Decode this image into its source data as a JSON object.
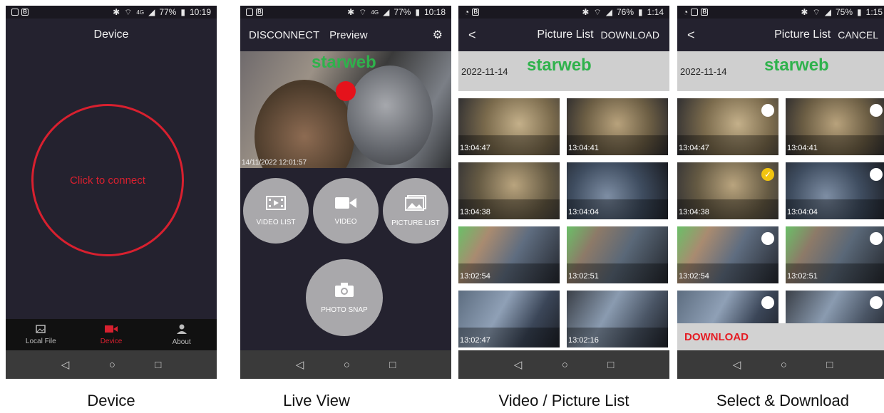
{
  "screens": [
    {
      "status": {
        "icons": [
          "▬",
          "B"
        ],
        "right": [
          "✱",
          "⌔",
          "4G",
          "◢",
          "77%",
          "▮",
          "10:19"
        ]
      },
      "title": "Device",
      "connect_label": "Click to connect",
      "tabs": [
        {
          "label": "Local File",
          "icon": "image-icon"
        },
        {
          "label": "Device",
          "icon": "camera-icon"
        },
        {
          "label": "About",
          "icon": "user-icon"
        }
      ],
      "caption": "Device"
    },
    {
      "status": {
        "icons": [
          "▬",
          "B"
        ],
        "right": [
          "✱",
          "⌔",
          "4G",
          "◢",
          "77%",
          "▮",
          "10:18"
        ]
      },
      "disconnect": "DISCONNECT",
      "preview": "Preview",
      "watermark": "starweb",
      "timestamp": "14/11/2022  12:01:57",
      "buttons": [
        "VIDEO LIST",
        "VIDEO",
        "PICTURE LIST",
        "PHOTO SNAP"
      ],
      "caption": "Live View"
    },
    {
      "status": {
        "icons": [
          "◔",
          "B"
        ],
        "right": [
          "✱",
          "⌔",
          "◢",
          "76%",
          "▮",
          "1:14"
        ]
      },
      "title": "Picture List",
      "action": "DOWNLOAD",
      "date": "2022-11-14",
      "watermark": "starweb",
      "times": [
        "13:04:47",
        "13:04:41",
        "13:04:38",
        "13:04:04",
        "13:02:54",
        "13:02:51",
        "13:02:47",
        "13:02:16"
      ],
      "caption": "Video / Picture List"
    },
    {
      "status": {
        "icons": [
          "◔",
          "▬",
          "B"
        ],
        "right": [
          "✱",
          "⌔",
          "◢",
          "75%",
          "▮",
          "1:15"
        ]
      },
      "title": "Picture List",
      "action": "CANCEL",
      "date": "2022-11-14",
      "watermark": "starweb",
      "times": [
        "13:04:47",
        "13:04:41",
        "13:04:38",
        "13:04:04",
        "13:02:54",
        "13:02:51",
        "",
        ""
      ],
      "download_label": "DOWNLOAD",
      "caption": "Select & Download"
    }
  ],
  "nav": [
    "◁",
    "○",
    "□"
  ]
}
